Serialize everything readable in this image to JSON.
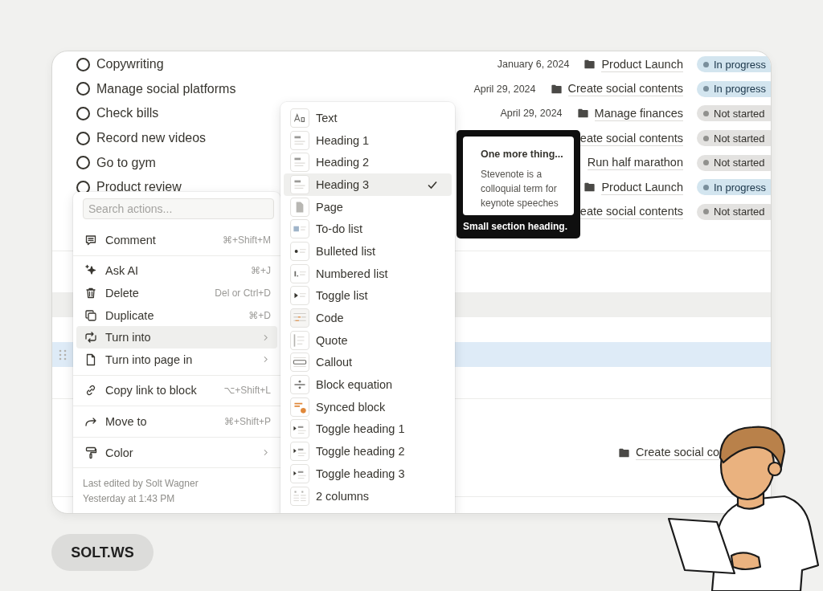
{
  "tasks": [
    {
      "title": "Copywriting",
      "done": false,
      "date": "January 6, 2024",
      "project_icon": true,
      "project": "Product Launch",
      "status": {
        "label": "In progress",
        "kind": "in_progress"
      }
    },
    {
      "title": "Manage social platforms",
      "done": false,
      "date": "April 29, 2024",
      "project_icon": true,
      "project": "Create social contents",
      "status": {
        "label": "In progress",
        "kind": "in_progress"
      }
    },
    {
      "title": "Check bills",
      "done": false,
      "date": "April 29, 2024",
      "project_icon": true,
      "project": "Manage finances",
      "status": {
        "label": "Not started",
        "kind": "not_started"
      }
    },
    {
      "title": "Record new videos",
      "done": false,
      "project_icon": false,
      "project": "eate social contents",
      "status": {
        "label": "Not started",
        "kind": "not_started"
      }
    },
    {
      "title": "Go to gym",
      "done": false,
      "project_icon": false,
      "project": "Run half marathon",
      "status": {
        "label": "Not started",
        "kind": "not_started"
      }
    },
    {
      "title": "Product review",
      "done": false,
      "project_icon": true,
      "project": "Product Launch",
      "status": {
        "label": "In progress",
        "kind": "in_progress"
      }
    },
    {
      "project_icon": false,
      "project": "eate social contents",
      "status": {
        "label": "Not started",
        "kind": "not_started"
      }
    }
  ],
  "blocks": [
    {
      "kind": "divider"
    },
    {
      "kind": "row"
    },
    {
      "kind": "hovered_row"
    },
    {
      "kind": "row"
    },
    {
      "kind": "selected_row"
    },
    {
      "kind": "row"
    },
    {
      "kind": "divider"
    },
    {
      "kind": "row"
    },
    {
      "kind": "row",
      "project_icon": true,
      "project": "Create social co"
    },
    {
      "kind": "row"
    },
    {
      "kind": "divider"
    }
  ],
  "actions_menu": {
    "search": {
      "placeholder": "Search actions..."
    },
    "sections": [
      [
        {
          "label": "Comment",
          "kind": "comment",
          "shortcut": "⌘+Shift+M",
          "submenu": false,
          "selected": false
        }
      ],
      [
        {
          "label": "Ask AI",
          "kind": "sparkle",
          "shortcut": "⌘+J",
          "submenu": false,
          "selected": false
        },
        {
          "label": "Delete",
          "kind": "trash",
          "shortcut": "Del or Ctrl+D",
          "submenu": false,
          "selected": false
        },
        {
          "label": "Duplicate",
          "kind": "duplicate",
          "shortcut": "⌘+D",
          "submenu": false,
          "selected": false
        },
        {
          "label": "Turn into",
          "kind": "turn",
          "submenu": true,
          "selected": true
        },
        {
          "label": "Turn into page in",
          "kind": "page",
          "submenu": true,
          "selected": false
        }
      ],
      [
        {
          "label": "Copy link to block",
          "kind": "link",
          "shortcut": "⌥+Shift+L",
          "submenu": false,
          "selected": false
        }
      ],
      [
        {
          "label": "Move to",
          "kind": "arrow",
          "shortcut": "⌘+Shift+P",
          "submenu": false,
          "selected": false
        }
      ],
      [
        {
          "label": "Color",
          "kind": "paint",
          "submenu": true,
          "selected": false
        }
      ]
    ],
    "footer": [
      "Last edited by Solt Wagner",
      "Yesterday at 1:43 PM"
    ]
  },
  "turn_into_menu": [
    {
      "label": "Text",
      "kind": "text",
      "selected": false
    },
    {
      "label": "Heading 1",
      "kind": "heading",
      "selected": false
    },
    {
      "label": "Heading 2",
      "kind": "heading",
      "selected": false
    },
    {
      "label": "Heading 3",
      "kind": "heading",
      "selected": true
    },
    {
      "label": "Page",
      "kind": "page",
      "selected": false
    },
    {
      "label": "To-do list",
      "kind": "todo",
      "selected": false
    },
    {
      "label": "Bulleted list",
      "kind": "bullet",
      "selected": false
    },
    {
      "label": "Numbered list",
      "kind": "numbered",
      "selected": false
    },
    {
      "label": "Toggle list",
      "kind": "toggle",
      "selected": false
    },
    {
      "label": "Code",
      "kind": "code",
      "selected": false
    },
    {
      "label": "Quote",
      "kind": "quote",
      "selected": false
    },
    {
      "label": "Callout",
      "kind": "callout",
      "selected": false
    },
    {
      "label": "Block equation",
      "kind": "equation",
      "selected": false
    },
    {
      "label": "Synced block",
      "kind": "synced",
      "selected": false
    },
    {
      "label": "Toggle heading 1",
      "kind": "toggle_heading",
      "selected": false
    },
    {
      "label": "Toggle heading 2",
      "kind": "toggle_heading",
      "selected": false
    },
    {
      "label": "Toggle heading 3",
      "kind": "toggle_heading",
      "selected": false
    },
    {
      "label": "2 columns",
      "kind": "columns",
      "selected": false
    }
  ],
  "tooltip": {
    "preview_title": "One more thing...",
    "preview_text": "Stevenote is a colloquial term for keynote speeches",
    "caption": "Small section heading."
  },
  "brand": "SOLT.WS"
}
